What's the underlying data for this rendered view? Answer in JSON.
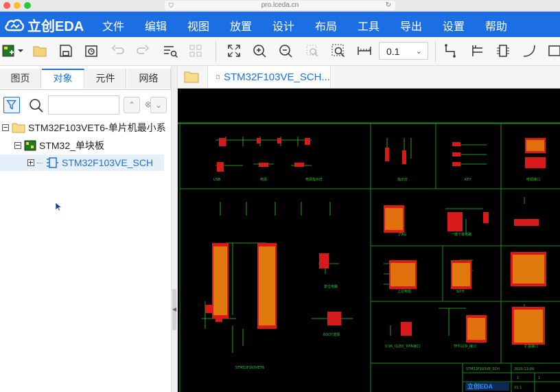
{
  "browser": {
    "url": "pro.lceda.cn"
  },
  "app": {
    "logo_text": "立创EDA",
    "menu": [
      "文件",
      "编辑",
      "视图",
      "放置",
      "设计",
      "布局",
      "工具",
      "导出",
      "设置",
      "帮助"
    ]
  },
  "toolbar": {
    "zoom_value": "0.1",
    "buttons": [
      "new-project-icon",
      "open-folder-icon",
      "save-icon",
      "history-icon",
      "undo-icon",
      "redo-icon",
      "find-icon",
      "grid-icon",
      "fit-icon",
      "zoom-in-icon",
      "zoom-out-icon",
      "zoom-area-icon",
      "zoom-selected-icon",
      "ruler-icon",
      "wire-icon",
      "bus-icon",
      "component-icon",
      "arc-icon",
      "rect-icon"
    ]
  },
  "left_panel": {
    "tabs": [
      "图页",
      "对象",
      "元件",
      "网络"
    ],
    "active_tab": 1,
    "tree": [
      {
        "label": "STM32F103VET6-单片机最小系",
        "level": 0,
        "icon": "folder-icon"
      },
      {
        "label": "STM32_单块板",
        "level": 1,
        "icon": "board-icon"
      },
      {
        "label": "STM32F103VE_SCH",
        "level": 2,
        "icon": "schematic-icon",
        "selected": true
      }
    ]
  },
  "document": {
    "tab_label": "STM32F103VE_SCH..."
  },
  "schematic": {
    "labels": {
      "usb": "USB",
      "power": "电源",
      "power_indicator": "电源指示灯",
      "indicator": "指示灯",
      "key": "KEY",
      "power_port": "电源接口",
      "jtag": "JTAG",
      "one_key_download": "一键下载电路",
      "reset_circuit": "复位电路",
      "boot_mode": "BOOT选择",
      "chip_label": "STM32F103VET6",
      "pullup": "上拉电阻",
      "sd_card": "SD卡",
      "oled": "0.96_OLED_7PIN接口",
      "tft_lcd": "TFT-LCD_接口",
      "expand": "扩展接口",
      "title_name": "STM32F103VE_SCH",
      "date": "2020-11-09",
      "version": "V1.1",
      "logo": "立创EDA",
      "page_a": "1",
      "page_b": "1"
    }
  },
  "colors": {
    "brand_blue": "#1c6fe3",
    "schematic_border": "#1e8a1e",
    "wire": "#28c828",
    "component": "#e02020",
    "pin_text": "#f0d000"
  }
}
